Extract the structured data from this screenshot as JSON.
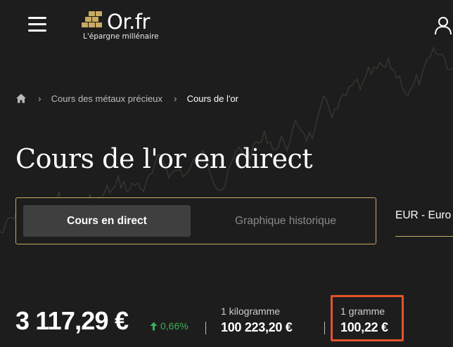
{
  "header": {
    "menu_icon": "hamburger-menu-icon",
    "logo": {
      "name": "Or.fr",
      "tagline": "L'épargne millénaire",
      "accent_color": "#c9aa62"
    },
    "user_icon": "user-icon"
  },
  "breadcrumb": {
    "home_icon": "home-icon",
    "items": [
      {
        "label": "Cours des métaux précieux"
      },
      {
        "label": "Cours de l'or"
      }
    ]
  },
  "title": "Cours de l'or en direct",
  "tabs": [
    {
      "label": "Cours en direct",
      "active": true
    },
    {
      "label": "Graphique historique",
      "active": false
    }
  ],
  "currency": {
    "selected": "EUR - Euro"
  },
  "price": {
    "main": "3 117,29 €",
    "change": "0,66%",
    "change_color": "#3fae5a",
    "kilogram": {
      "label": "1 kilogramme",
      "value": "100 223,20 €"
    },
    "gram": {
      "label": "1 gramme",
      "value": "100,22 €",
      "highlight_color": "#e2542c"
    }
  },
  "colors": {
    "background": "#1d1d1d",
    "gold_accent": "#c9aa62"
  }
}
